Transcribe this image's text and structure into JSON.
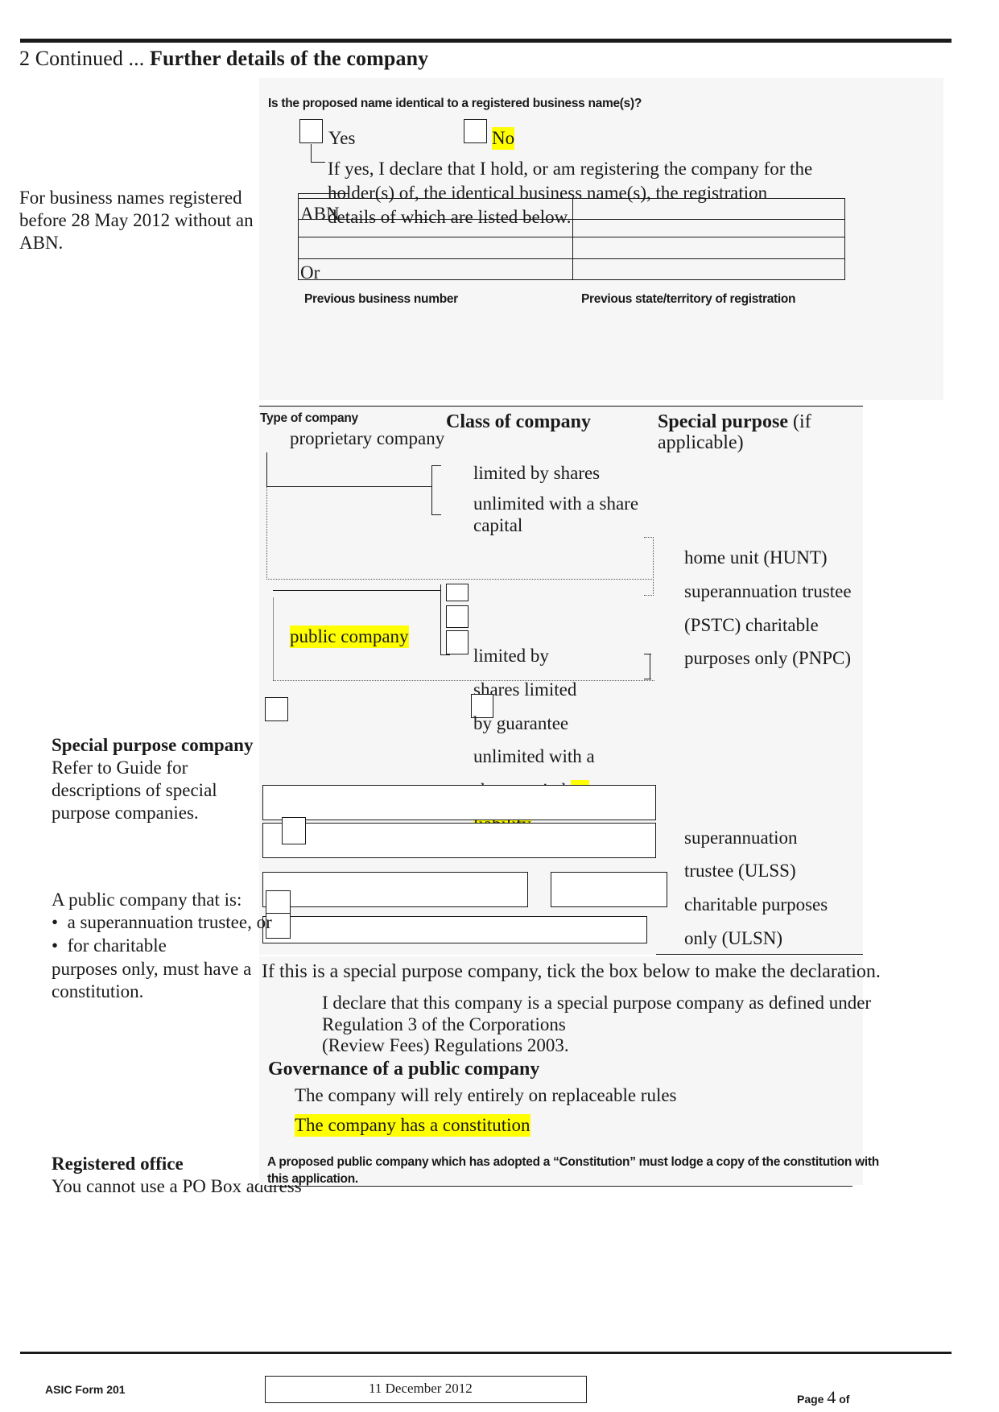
{
  "header": {
    "section_number": "2",
    "continued": "Continued ...",
    "title": "Further details of the company"
  },
  "business_name_block": {
    "margin_note": "For business names registered before 28 May 2012 without an ABN.",
    "question": "Is the proposed name identical to a registered business name(s)?",
    "option_yes": "Yes",
    "option_no": "No",
    "declaration": "If yes, I declare that I hold, or am registering the company for the holder(s) of, the identical business name(s), the registration details of which are listed below.",
    "abn_label": "ABN",
    "or_label": "Or",
    "col_label_left": "Previous business number",
    "col_label_right": "Previous state/territory of registration"
  },
  "company_table": {
    "col_type_heading": "Type of company",
    "col_class_heading": "Class of company",
    "col_special_heading_bold": "Special purpose",
    "col_special_heading_rest": "(if applicable)",
    "type_options": [
      "proprietary company",
      "public company"
    ],
    "class_options": [
      "limited by shares",
      "unlimited with a share capital",
      "limited by shares limited by guarantee",
      "unlimited with a share capital no liability"
    ],
    "class_fragment_1": "limited by shares",
    "class_fragment_2": "unlimited with a share capital",
    "class_fragment_3": "limited by",
    "class_fragment_4": "shares limited",
    "class_fragment_5": "by guarantee",
    "class_fragment_6": "unlimited with a",
    "class_fragment_7a": "share capital ",
    "class_fragment_7b": "no",
    "class_fragment_8": "liability",
    "special_options": [
      "home unit (HUNT)",
      "superannuation trustee (PSTC) charitable purposes only (PNPC)",
      "superannuation trustee (ULSS) charitable purposes only (ULSN)"
    ],
    "special_line_1": "home unit (HUNT)",
    "special_line_2": "superannuation trustee",
    "special_line_3": "(PSTC) charitable",
    "special_line_4": "purposes only (PNPC)",
    "special_line_5": "superannuation",
    "special_line_6": "trustee (ULSS)",
    "special_line_7": "charitable purposes",
    "special_line_8": "only (ULSN)"
  },
  "margin_notes": {
    "special_purpose_bold": "Special purpose company",
    "special_purpose_rest": " Refer to Guide for descriptions of special purpose companies.",
    "public_company_intro": "A public company that is:",
    "bullet_1": "a superannuation trustee, or",
    "bullet_2": "for charitable",
    "bullet_tail": "purposes only, must have a constitution.",
    "registered_office_bold": "Registered office",
    "registered_office_rest": "You cannot use a PO Box address"
  },
  "declaration_block": {
    "intro": "If this is a special purpose company, tick the box below to make the declaration.",
    "text_line_1": "I declare that this company is a special purpose company as defined under",
    "text_line_2": "Regulation 3 of the Corporations",
    "text_line_3": "(Review Fees) Regulations 2003."
  },
  "governance_block": {
    "heading": "Governance of a public company",
    "option_replaceable": "The company will rely entirely on replaceable rules",
    "option_constitution": "The company has a constitution",
    "note_line_1": "A proposed public company which has adopted a “Constitution” must lodge a copy of the constitution with",
    "note_line_2": "this application."
  },
  "footer": {
    "form_label": "ASIC Form 201",
    "date": "11 December 2012",
    "page_prefix": "Page",
    "page_number": "4",
    "page_suffix": "of"
  },
  "colors": {
    "highlight": "#ffff00",
    "panel": "#f6f6f6",
    "ink": "#1a1a1a"
  }
}
